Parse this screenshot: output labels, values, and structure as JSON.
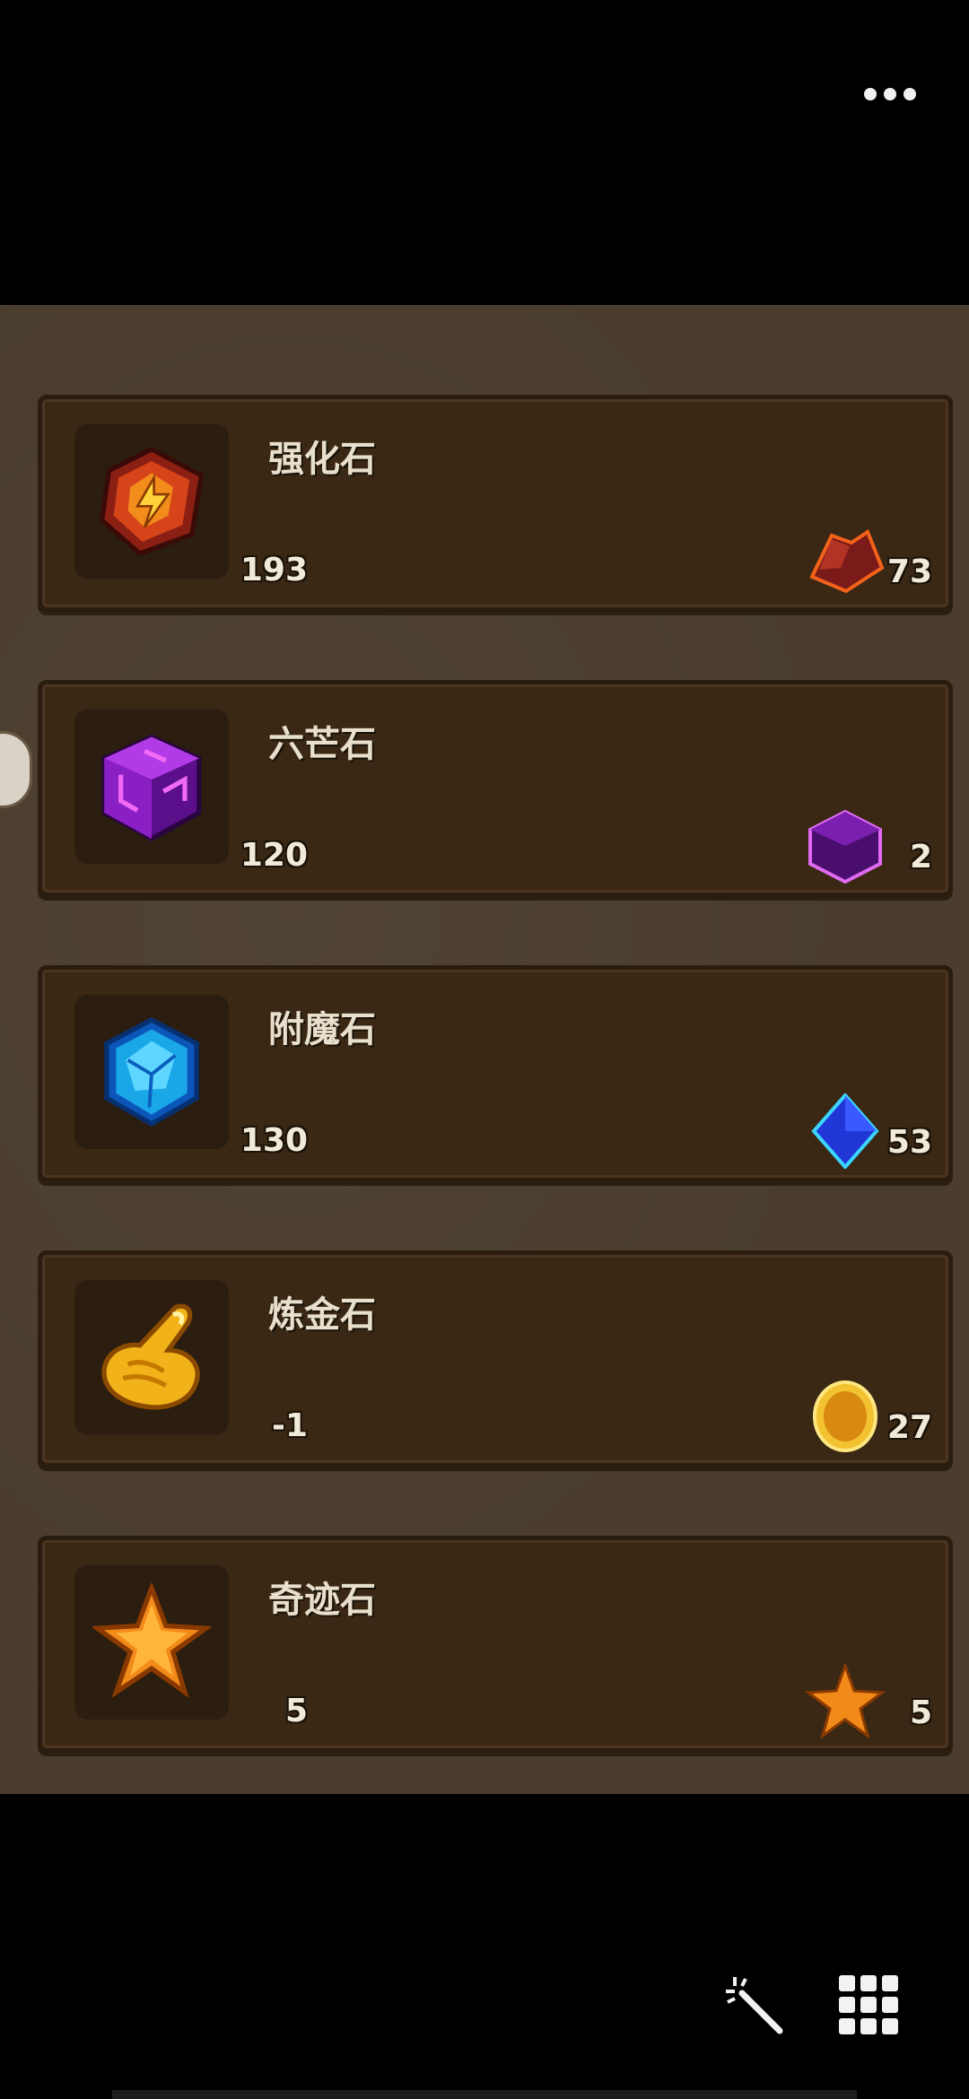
{
  "items": [
    {
      "name": "强化石",
      "stock": "193",
      "count": "73",
      "icon": "enhance-stone-icon",
      "mini_icon": "red-ore-icon",
      "color": "#d24a1e"
    },
    {
      "name": "六芒石",
      "stock": "120",
      "count": "2",
      "icon": "hexagram-stone-icon",
      "mini_icon": "purple-cube-icon",
      "color": "#9b2bd6"
    },
    {
      "name": "附魔石",
      "stock": "130",
      "count": "53",
      "icon": "enchant-stone-icon",
      "mini_icon": "blue-diamond-icon",
      "color": "#1aa7e8"
    },
    {
      "name": "炼金石",
      "stock": "-1",
      "count": "27",
      "icon": "alchemy-stone-icon",
      "mini_icon": "gold-coin-icon",
      "color": "#f2b21a"
    },
    {
      "name": "奇迹石",
      "stock": "5",
      "count": "5",
      "icon": "miracle-stone-icon",
      "mini_icon": "orange-star-icon",
      "color": "#f28a1a"
    }
  ],
  "toolbar": {
    "more_icon": "more-dots-icon",
    "wand_icon": "magic-wand-icon",
    "grid_icon": "grid-menu-icon"
  }
}
